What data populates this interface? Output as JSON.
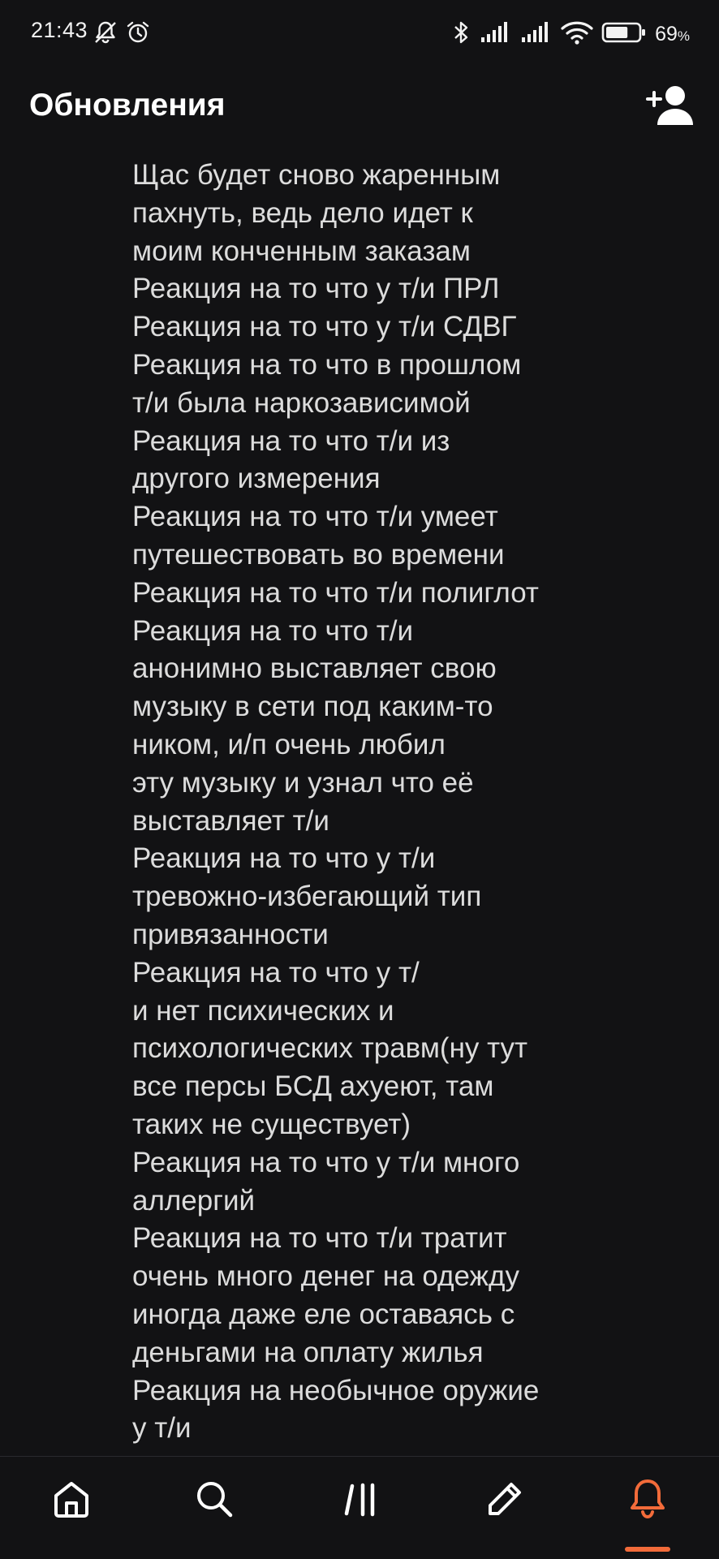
{
  "status_bar": {
    "time": "21:43",
    "battery_percent": "69",
    "battery_unit": "%",
    "battery_level": 0.69,
    "icons": [
      "bell-off-icon",
      "alarm-icon",
      "bluetooth-icon",
      "signal-icon",
      "signal-icon",
      "wifi-icon",
      "battery-icon"
    ]
  },
  "header": {
    "title": "Обновления",
    "add_friend_icon": "add-user-icon"
  },
  "content": {
    "lines": [
      "Щас будет сново жаренным",
      "пахнуть, ведь дело идет к",
      "моим конченным заказам",
      "Реакция на то что у т/и ПРЛ",
      "Реакция на то что у т/и СДВГ",
      "Реакция на то что в прошлом",
      "т/и была наркозависимой",
      "Реакция на то что т/и из",
      "другого измерения",
      "Реакция на то что т/и умеет",
      "путешествовать во времени",
      "Реакция на то что т/и полиглот",
      "Реакция на то что т/и",
      "анонимно выставляет свою",
      "музыку в сети под каким-то",
      "ником, и/п очень любил",
      "эту музыку и узнал что её",
      "выставляет т/и",
      "Реакция на то что у т/и",
      "тревожно-избегающий тип",
      "привязанности",
      "Реакция на то что у т/",
      "и нет психических и",
      "психологических травм(ну тут",
      "все персы БСД ахуеют, там",
      "таких не существует)",
      "Реакция на то что у т/и много",
      "аллергий",
      "Реакция на то что т/и тратит",
      "очень много денег на одежду",
      "иногда даже еле оставаясь с",
      "деньгами на оплату жилья",
      "Реакция на необычное оружие",
      "у т/и"
    ]
  },
  "bottom_nav": {
    "items": [
      {
        "icon": "home-icon"
      },
      {
        "icon": "search-icon"
      },
      {
        "icon": "library-icon"
      },
      {
        "icon": "pencil-icon"
      },
      {
        "icon": "bell-icon",
        "active": true
      }
    ],
    "accent_color": "#f26b3a"
  }
}
